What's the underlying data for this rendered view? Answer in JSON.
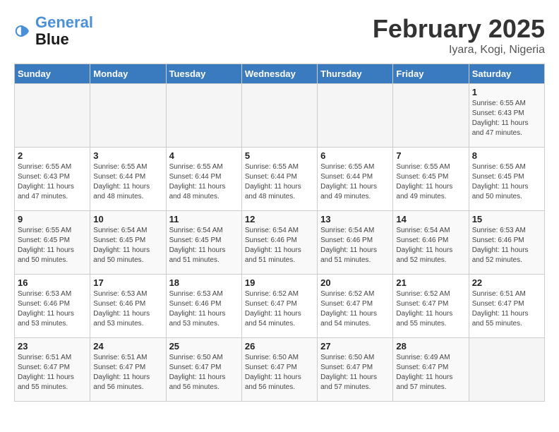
{
  "header": {
    "logo_line1": "General",
    "logo_line2": "Blue",
    "title": "February 2025",
    "subtitle": "Iyara, Kogi, Nigeria"
  },
  "weekdays": [
    "Sunday",
    "Monday",
    "Tuesday",
    "Wednesday",
    "Thursday",
    "Friday",
    "Saturday"
  ],
  "weeks": [
    [
      {
        "day": "",
        "info": ""
      },
      {
        "day": "",
        "info": ""
      },
      {
        "day": "",
        "info": ""
      },
      {
        "day": "",
        "info": ""
      },
      {
        "day": "",
        "info": ""
      },
      {
        "day": "",
        "info": ""
      },
      {
        "day": "1",
        "info": "Sunrise: 6:55 AM\nSunset: 6:43 PM\nDaylight: 11 hours and 47 minutes."
      }
    ],
    [
      {
        "day": "2",
        "info": "Sunrise: 6:55 AM\nSunset: 6:43 PM\nDaylight: 11 hours and 47 minutes."
      },
      {
        "day": "3",
        "info": "Sunrise: 6:55 AM\nSunset: 6:44 PM\nDaylight: 11 hours and 48 minutes."
      },
      {
        "day": "4",
        "info": "Sunrise: 6:55 AM\nSunset: 6:44 PM\nDaylight: 11 hours and 48 minutes."
      },
      {
        "day": "5",
        "info": "Sunrise: 6:55 AM\nSunset: 6:44 PM\nDaylight: 11 hours and 48 minutes."
      },
      {
        "day": "6",
        "info": "Sunrise: 6:55 AM\nSunset: 6:44 PM\nDaylight: 11 hours and 49 minutes."
      },
      {
        "day": "7",
        "info": "Sunrise: 6:55 AM\nSunset: 6:45 PM\nDaylight: 11 hours and 49 minutes."
      },
      {
        "day": "8",
        "info": "Sunrise: 6:55 AM\nSunset: 6:45 PM\nDaylight: 11 hours and 50 minutes."
      }
    ],
    [
      {
        "day": "9",
        "info": "Sunrise: 6:55 AM\nSunset: 6:45 PM\nDaylight: 11 hours and 50 minutes."
      },
      {
        "day": "10",
        "info": "Sunrise: 6:54 AM\nSunset: 6:45 PM\nDaylight: 11 hours and 50 minutes."
      },
      {
        "day": "11",
        "info": "Sunrise: 6:54 AM\nSunset: 6:45 PM\nDaylight: 11 hours and 51 minutes."
      },
      {
        "day": "12",
        "info": "Sunrise: 6:54 AM\nSunset: 6:46 PM\nDaylight: 11 hours and 51 minutes."
      },
      {
        "day": "13",
        "info": "Sunrise: 6:54 AM\nSunset: 6:46 PM\nDaylight: 11 hours and 51 minutes."
      },
      {
        "day": "14",
        "info": "Sunrise: 6:54 AM\nSunset: 6:46 PM\nDaylight: 11 hours and 52 minutes."
      },
      {
        "day": "15",
        "info": "Sunrise: 6:53 AM\nSunset: 6:46 PM\nDaylight: 11 hours and 52 minutes."
      }
    ],
    [
      {
        "day": "16",
        "info": "Sunrise: 6:53 AM\nSunset: 6:46 PM\nDaylight: 11 hours and 53 minutes."
      },
      {
        "day": "17",
        "info": "Sunrise: 6:53 AM\nSunset: 6:46 PM\nDaylight: 11 hours and 53 minutes."
      },
      {
        "day": "18",
        "info": "Sunrise: 6:53 AM\nSunset: 6:46 PM\nDaylight: 11 hours and 53 minutes."
      },
      {
        "day": "19",
        "info": "Sunrise: 6:52 AM\nSunset: 6:47 PM\nDaylight: 11 hours and 54 minutes."
      },
      {
        "day": "20",
        "info": "Sunrise: 6:52 AM\nSunset: 6:47 PM\nDaylight: 11 hours and 54 minutes."
      },
      {
        "day": "21",
        "info": "Sunrise: 6:52 AM\nSunset: 6:47 PM\nDaylight: 11 hours and 55 minutes."
      },
      {
        "day": "22",
        "info": "Sunrise: 6:51 AM\nSunset: 6:47 PM\nDaylight: 11 hours and 55 minutes."
      }
    ],
    [
      {
        "day": "23",
        "info": "Sunrise: 6:51 AM\nSunset: 6:47 PM\nDaylight: 11 hours and 55 minutes."
      },
      {
        "day": "24",
        "info": "Sunrise: 6:51 AM\nSunset: 6:47 PM\nDaylight: 11 hours and 56 minutes."
      },
      {
        "day": "25",
        "info": "Sunrise: 6:50 AM\nSunset: 6:47 PM\nDaylight: 11 hours and 56 minutes."
      },
      {
        "day": "26",
        "info": "Sunrise: 6:50 AM\nSunset: 6:47 PM\nDaylight: 11 hours and 56 minutes."
      },
      {
        "day": "27",
        "info": "Sunrise: 6:50 AM\nSunset: 6:47 PM\nDaylight: 11 hours and 57 minutes."
      },
      {
        "day": "28",
        "info": "Sunrise: 6:49 AM\nSunset: 6:47 PM\nDaylight: 11 hours and 57 minutes."
      },
      {
        "day": "",
        "info": ""
      }
    ]
  ]
}
